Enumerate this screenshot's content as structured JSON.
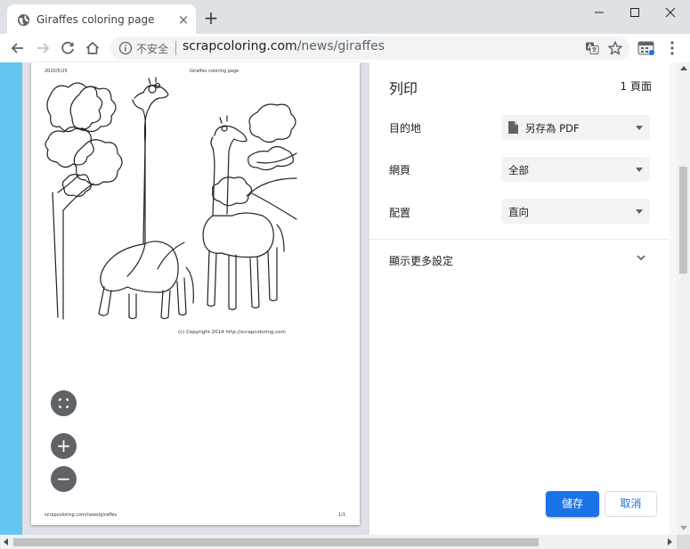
{
  "browser": {
    "tab_title": "Giraffes coloring page",
    "new_tab": "+",
    "close": "×",
    "security_label": "不安全",
    "url_host": "scrapcoloring.com",
    "url_path": "/news/giraffes"
  },
  "preview": {
    "header_date": "2020/5/25",
    "header_title": "Giraffes coloring page",
    "copyright": "(c) Copyright 2014 http://scrapcoloring.com",
    "footer_url": "scrapcoloring.com/news/giraffes",
    "footer_page": "1/1",
    "zoom_in": "+",
    "zoom_out": "−"
  },
  "print": {
    "title": "列印",
    "page_count": "1 頁面",
    "destination_label": "目的地",
    "destination_value": "另存為 PDF",
    "pages_label": "網頁",
    "pages_value": "全部",
    "layout_label": "配置",
    "layout_value": "直向",
    "more_settings": "顯示更多設定",
    "save": "儲存",
    "cancel": "取消"
  },
  "colors": {
    "accent": "#1a73e8",
    "page_blue": "#63c6f2"
  }
}
